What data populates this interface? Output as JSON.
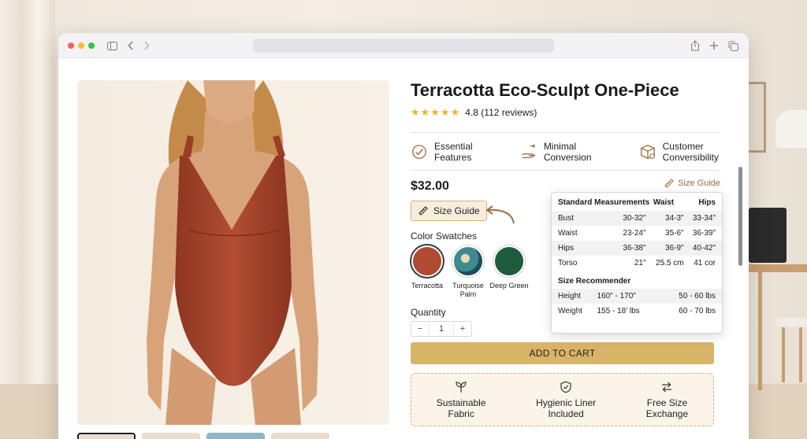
{
  "browser": {
    "controls": [
      "sidebar-icon",
      "back-icon",
      "forward-icon",
      "share-icon",
      "new-tab-icon",
      "tabs-icon"
    ]
  },
  "product": {
    "title": "Terracotta Eco-Sculpt One-Piece",
    "stars": "★★★★★",
    "rating": "4.8 (112 reviews)",
    "price": "$32.00",
    "size_guide_link": "Size Guide",
    "size_guide_button": "Size Guide",
    "color_label": "Color Swatches",
    "quantity_label": "Quantity",
    "quantity_minus": "−",
    "quantity_value": "1",
    "quantity_plus": "+",
    "add_to_cart": "ADD TO CART"
  },
  "features": [
    {
      "line1": "Essential",
      "line2": "Features",
      "icon": "check-circle-icon"
    },
    {
      "line1": "Minimal",
      "line2": "Conversion",
      "icon": "hand-swipe-icon"
    },
    {
      "line1": "Customer",
      "line2": "Conversibility",
      "icon": "box-icon"
    }
  ],
  "swatches": [
    {
      "name": "Terracotta",
      "color": "#b04a33",
      "selected": true
    },
    {
      "name": "Turquoise Palm",
      "color": "#3f8a91",
      "selected": false
    },
    {
      "name": "Deep Green",
      "color": "#1f5c3e",
      "selected": false
    }
  ],
  "size_guide": {
    "headers": [
      "Standard Measurements",
      "Waist",
      "Hips"
    ],
    "rows": [
      [
        "Bust",
        "30-32\"",
        "34-3\"",
        "33-34\""
      ],
      [
        "Waist",
        "23-24\"",
        "35-6\"",
        "36-39\""
      ],
      [
        "Hips",
        "36-38\"",
        "36-9\"",
        "40-42\""
      ],
      [
        "Torso",
        "21\"",
        "25.5 cm",
        "41 cor"
      ]
    ],
    "recommender_title": "Size Recommender",
    "recommender": [
      [
        "Height",
        "160\" - 170\"",
        "50 - 60 lbs"
      ],
      [
        "Weight",
        "155 - 18' lbs",
        "60 - 70 lbs"
      ]
    ]
  },
  "perks": [
    {
      "line1": "Sustainable",
      "line2": "Fabric",
      "icon": "leaf-icon"
    },
    {
      "line1": "Hygienic Liner",
      "line2": "Included",
      "icon": "shield-check-icon"
    },
    {
      "line1": "Free Size",
      "line2": "Exchange",
      "icon": "swap-arrows-icon"
    }
  ],
  "colors": {
    "accent": "#d8b468",
    "star": "#f0b429",
    "link": "#9a6b3e",
    "swimsuit": "#a9452e"
  }
}
